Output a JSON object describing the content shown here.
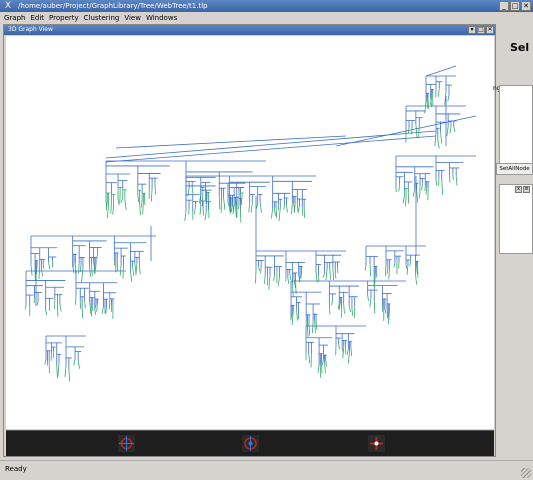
{
  "window": {
    "title": "/home/auber/Project/GraphLibrary/Tree/WebTree/t1.tlp",
    "icon": "x-app-icon"
  },
  "window_buttons": [
    "_",
    "□",
    "✕"
  ],
  "menubar": {
    "items": [
      "Graph",
      "Edit",
      "Property",
      "Clustering",
      "View",
      "Windows"
    ]
  },
  "graph_view": {
    "title": "3D Graph View",
    "buttons": [
      "▾",
      "□",
      "✕"
    ]
  },
  "right_panel": {
    "heading": "Sel",
    "ranges_label": "nges",
    "setall_label": "SetAllNode",
    "box_buttons": [
      "x",
      "≡"
    ]
  },
  "status": {
    "text": "Ready"
  },
  "colors": {
    "edge_blue": "#3b6fc6",
    "edge_green": "#34a86c",
    "titlebar": "#4a72b0"
  }
}
